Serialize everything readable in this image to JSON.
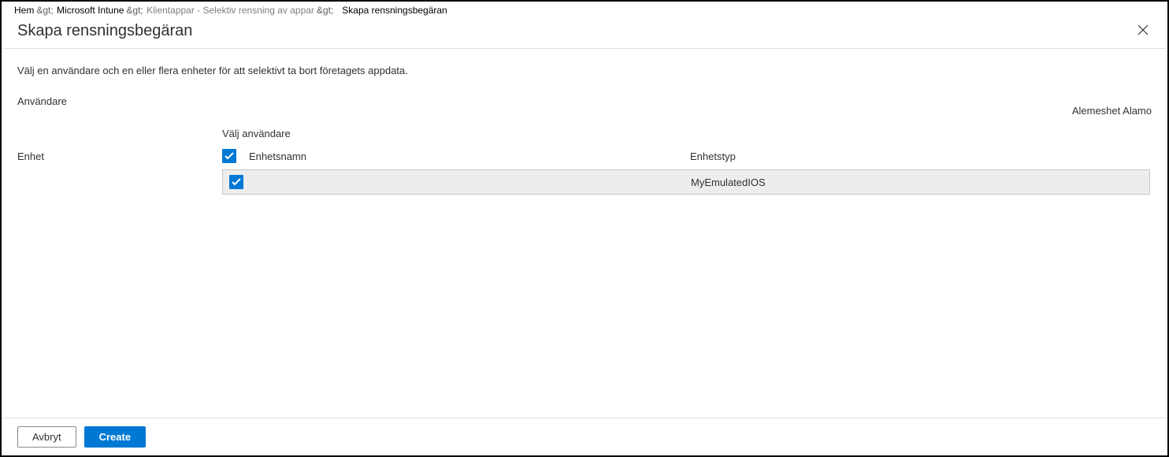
{
  "breadcrumbs": {
    "items": [
      {
        "label": "Hem",
        "sep": "&gt;"
      },
      {
        "label": "Microsoft Intune",
        "sep": "&gt;"
      },
      {
        "label": "Klientappar - Selektiv rensning av appar",
        "sep": "&gt;",
        "gray": true
      },
      {
        "label": "Skapa rensningsbegäran",
        "current": true
      }
    ]
  },
  "header": {
    "title": "Skapa rensningsbegäran"
  },
  "instruction": "Välj en användare och en eller flera enheter för att selektivt ta bort företagets appdata.",
  "user": {
    "label": "Användare",
    "value": "Alemeshet Alamo",
    "select_label": "Välj användare"
  },
  "device": {
    "label": "Enhet",
    "table": {
      "header_checked": true,
      "columns": {
        "name": "Enhetsnamn",
        "type": "Enhetstyp"
      },
      "rows": [
        {
          "checked": true,
          "name": "",
          "type": "MyEmulatedIOS"
        }
      ]
    }
  },
  "footer": {
    "cancel": "Avbryt",
    "create": "Create"
  }
}
